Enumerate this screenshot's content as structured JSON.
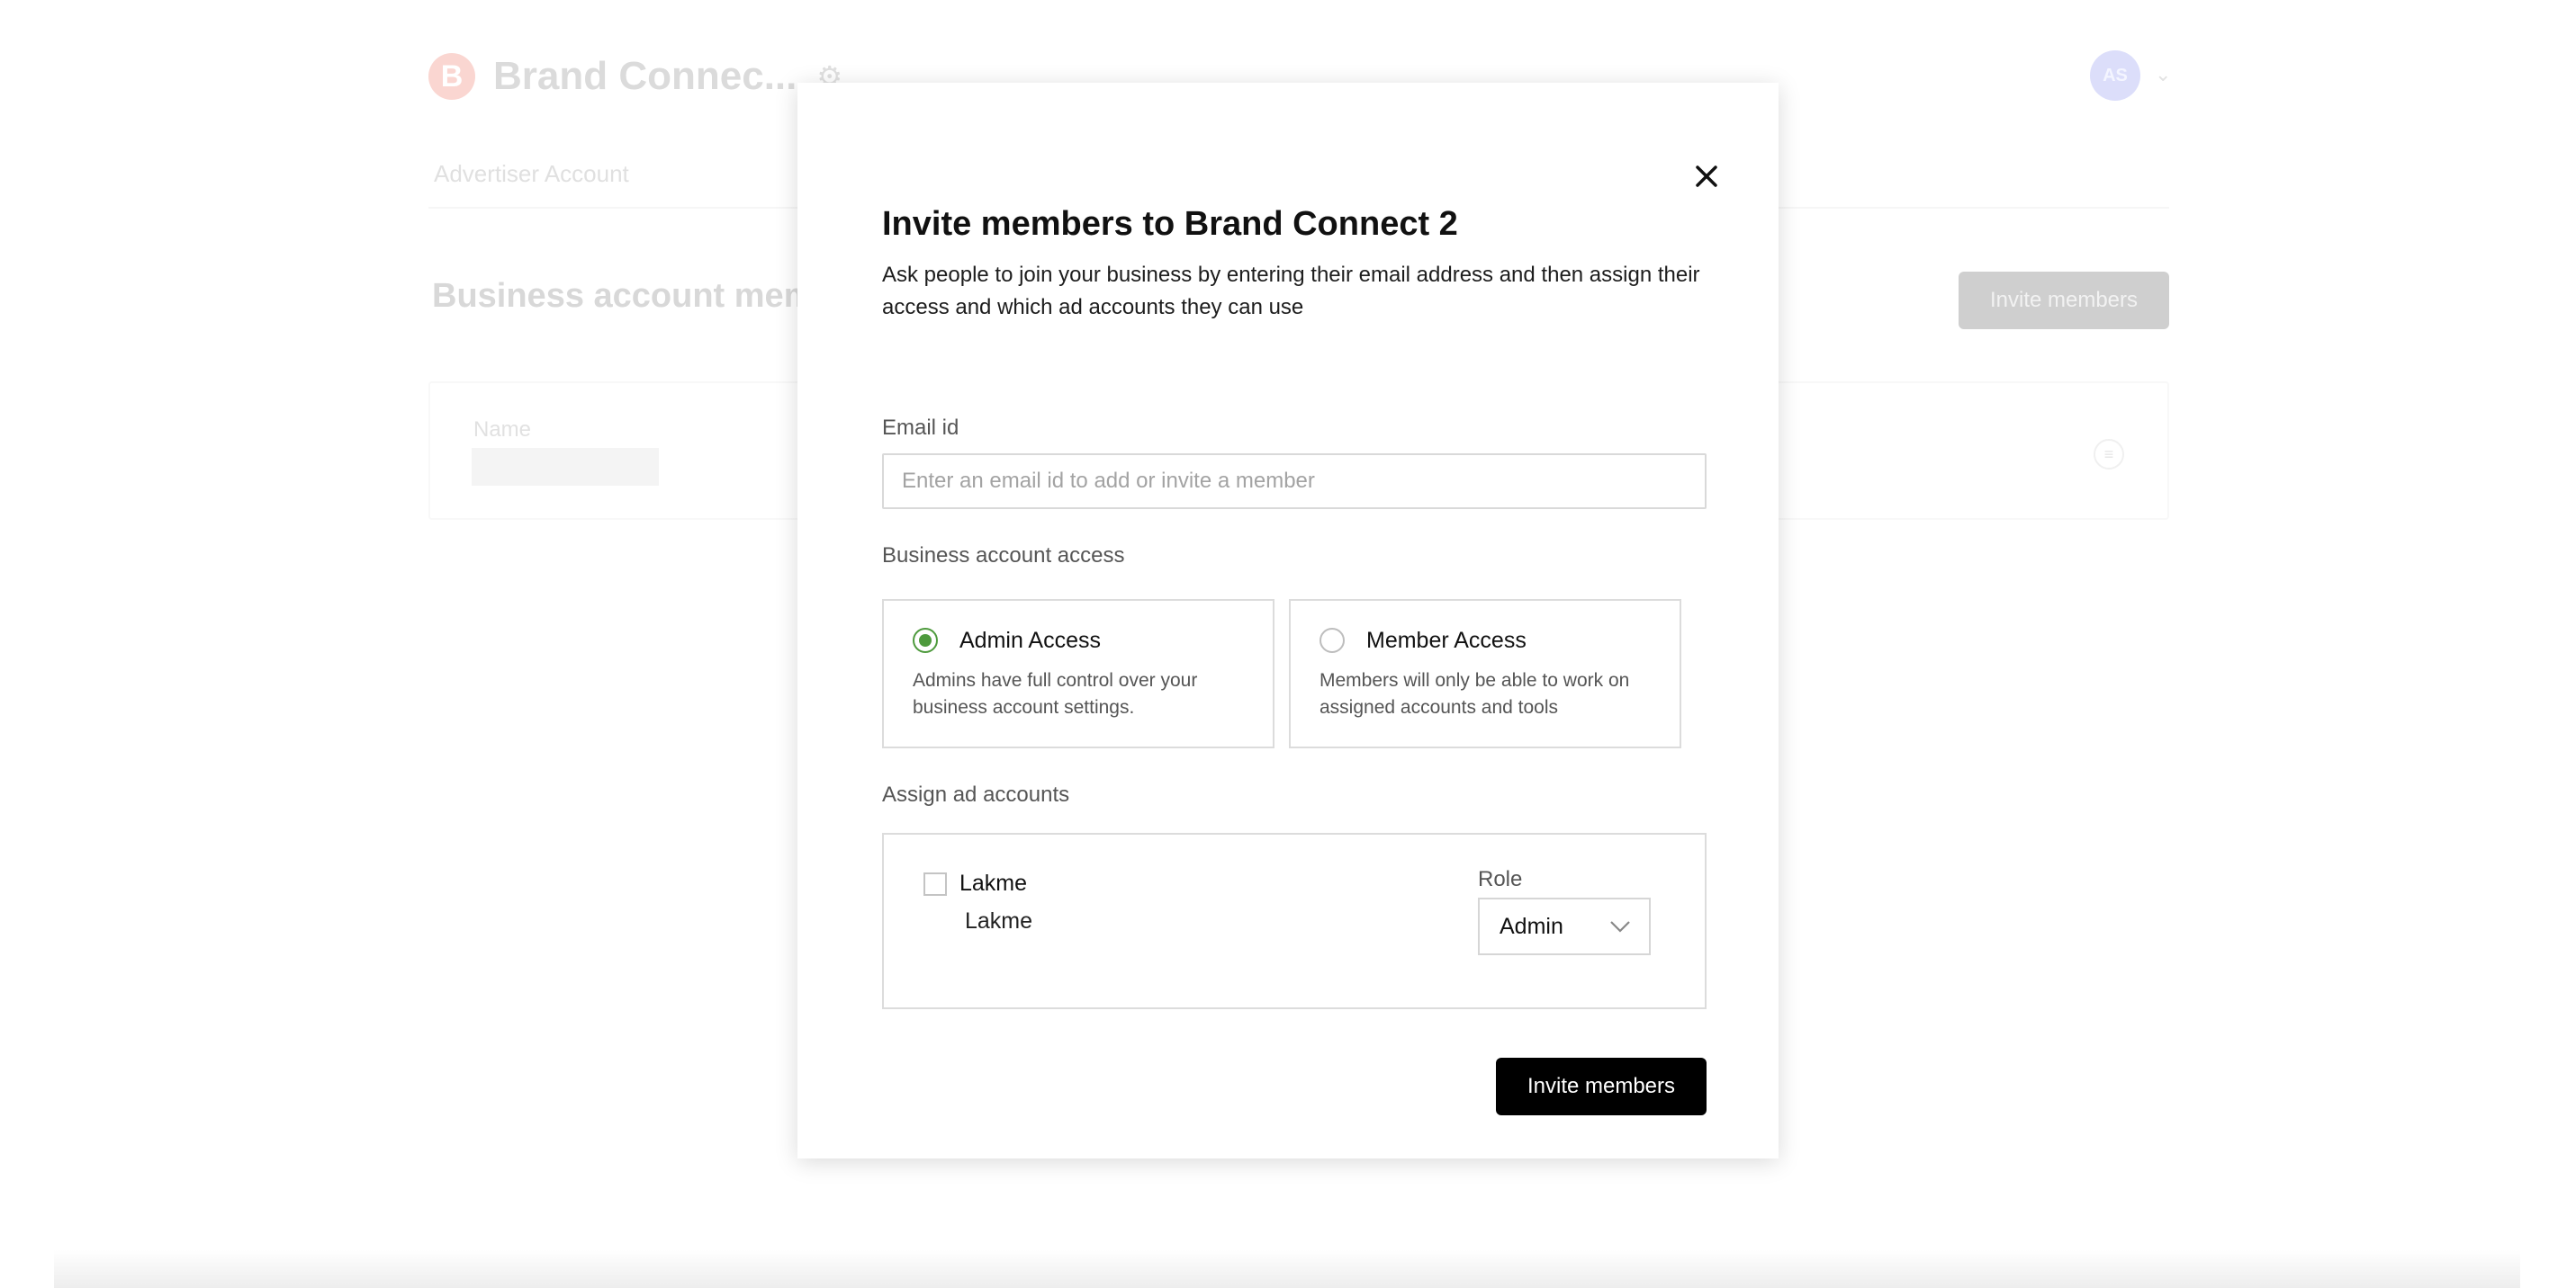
{
  "background": {
    "brand_initial": "B",
    "brand_name": "Brand Connec...",
    "avatar_initials": "AS",
    "tab_advertiser": "Advertiser Account",
    "section_title": "Business account memb",
    "invite_button": "Invite members",
    "table_column_name": "Name"
  },
  "modal": {
    "title": "Invite members to Brand Connect 2",
    "description": "Ask people to join your business by entering their email address and then assign their access and which ad accounts they can use",
    "email": {
      "label": "Email id",
      "placeholder": "Enter an email id to add or invite a member",
      "value": ""
    },
    "access": {
      "label": "Business account access",
      "options": [
        {
          "title": "Admin Access",
          "description": "Admins have full control over your business account settings.",
          "selected": true
        },
        {
          "title": "Member Access",
          "description": "Members will only be able to work on assigned accounts and tools",
          "selected": false
        }
      ]
    },
    "ad_accounts": {
      "label": "Assign ad accounts",
      "items": [
        {
          "name": "Lakme",
          "subtitle": "Lakme",
          "checked": false,
          "role_label": "Role",
          "role_value": "Admin"
        }
      ]
    },
    "submit_label": "Invite members"
  },
  "colors": {
    "accent_green": "#4e9a3d",
    "primary_button": "#000000"
  }
}
